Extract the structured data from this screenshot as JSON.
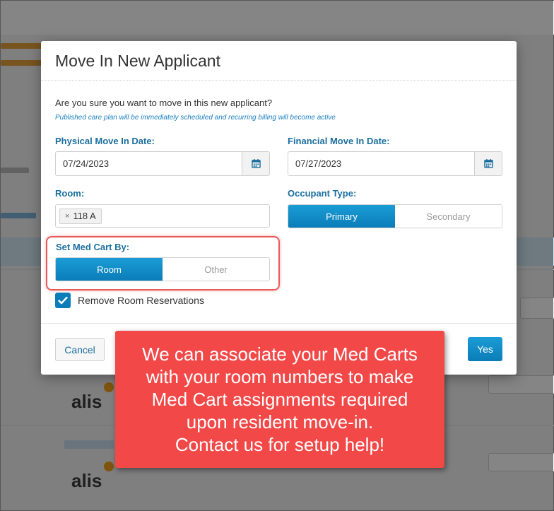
{
  "modal": {
    "title": "Move In New Applicant",
    "question": "Are you sure you want to move in this new applicant?",
    "note": "Published care plan will be immediately scheduled and recurring billing will become active",
    "physical_move_in": {
      "label": "Physical Move In Date:",
      "value": "07/24/2023"
    },
    "financial_move_in": {
      "label": "Financial Move In Date:",
      "value": "07/27/2023"
    },
    "room": {
      "label": "Room:",
      "tag_remove": "×",
      "tag_value": "118 A"
    },
    "occupant_type": {
      "label": "Occupant Type:",
      "options": [
        "Primary",
        "Secondary"
      ],
      "selected": "Primary"
    },
    "med_cart": {
      "label": "Set Med Cart By:",
      "options": [
        "Room",
        "Other"
      ],
      "selected": "Room"
    },
    "remove_reservations": {
      "label": "Remove Room Reservations",
      "checked": true
    },
    "cancel_label": "Cancel",
    "yes_label": "Yes"
  },
  "callout": {
    "text": "We can associate your Med Carts\nwith your room numbers to make\nMed Cart assignments required\nupon resident move-in.\nContact us for setup help!"
  },
  "colors": {
    "accent": "#0b7db8",
    "label": "#1b6f9e",
    "callout": "#f24848",
    "highlight": "#e85a5a"
  }
}
